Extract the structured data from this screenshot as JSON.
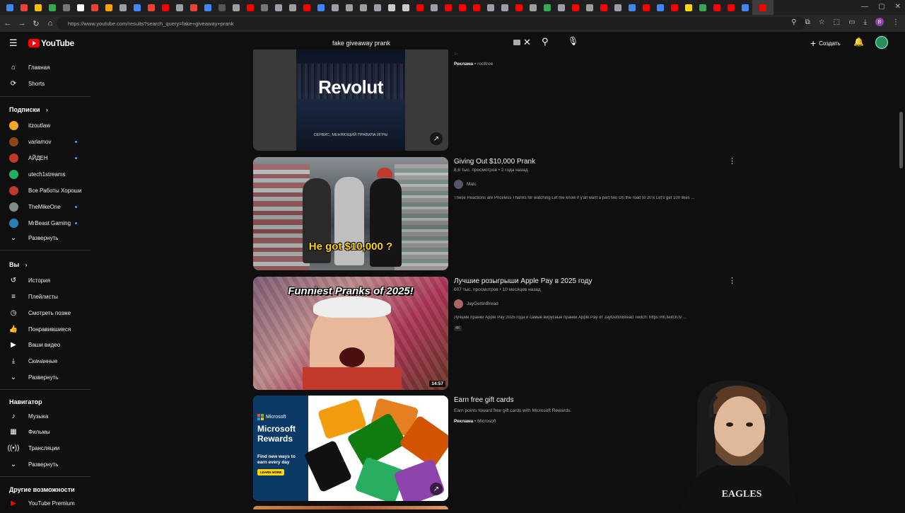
{
  "browser": {
    "url": "https://www.youtube.com/results?search_query=fake+giveaway+prank",
    "profile_initial": "B",
    "tab_colors": [
      "#4285f4",
      "#ea4335",
      "#fbbc05",
      "#34a853",
      "#777",
      "#fff",
      "#ea4335",
      "#ffa000",
      "#9aa0a6",
      "#4285f4",
      "#ea4335",
      "#ff0000",
      "#9aa0a6",
      "#ea4335",
      "#4285f4",
      "#555",
      "#9aa0a6",
      "#ff0000",
      "#777",
      "#9aa0a6",
      "#9aa0a6",
      "#ff0000",
      "#4285f4",
      "#9aa0a6",
      "#9aa0a6",
      "#9aa0a6",
      "#9aa0a6",
      "#ccc",
      "#ccc",
      "#ff0000",
      "#9aa0a6",
      "#ff0000",
      "#ff0000",
      "#ff0000",
      "#9aa0a6",
      "#9aa0a6",
      "#ff0000",
      "#9aa0a6",
      "#34a853",
      "#9aa0a6",
      "#ff0000",
      "#9aa0a6",
      "#ff0000",
      "#9aa0a6",
      "#4285f4",
      "#ff0000",
      "#4285f4",
      "#ff0000",
      "#ffd700",
      "#34a853",
      "#ff0000",
      "#ff0000",
      "#4285f4",
      "#ff0000"
    ]
  },
  "header": {
    "logo_text": "YouTube",
    "search_value": "fake giveaway prank",
    "create_label": "Создать"
  },
  "sidebar": {
    "home": "Главная",
    "shorts": "Shorts",
    "subscriptions_title": "Подписки",
    "channels": [
      {
        "name": "itzoutlaw",
        "color": "#f5a623",
        "live": false
      },
      {
        "name": "varlamov",
        "color": "#8b4513",
        "live": true
      },
      {
        "name": "АЙДЕН",
        "color": "#c0392b",
        "live": true
      },
      {
        "name": "utech1streams",
        "color": "#27ae60",
        "live": false
      },
      {
        "name": "Все Работы Хороши",
        "color": "#c0392b",
        "live": false
      },
      {
        "name": "TheMikeOne",
        "color": "#7f8c8d",
        "live": true
      },
      {
        "name": "MrBeast Gaming",
        "color": "#2980b9",
        "live": true
      }
    ],
    "expand": "Развернуть",
    "you_title": "Вы",
    "you_items": [
      "История",
      "Плейлисты",
      "Смотреть позже",
      "Понравившиеся",
      "Ваши видео",
      "Скачанные",
      "Развернуть"
    ],
    "navigator_title": "Навигатор",
    "navigator_items": [
      "Музыка",
      "Фильмы",
      "Трансляции",
      "Развернуть"
    ],
    "other_title": "Другие возможности",
    "premium": "YouTube Premium"
  },
  "results": {
    "ad_top": {
      "desc_partial": "...",
      "ad_label": "Реклама",
      "advertiser": "roottree",
      "thumb_title": "Revolut",
      "thumb_sub": "СЕРВИС, МЕНЯЮЩИЙ ПРАВИЛА ИГРЫ"
    },
    "video1": {
      "title": "Giving Out $10,000 Prank",
      "meta": "8,6 тыс. просмотров • 2 года назад",
      "channel": "Malc",
      "desc": "These Reactions are Priceless Thanks for watching Let me know if y'all want a part two On the road to 20 k Let's get 100 likes ...",
      "thumb_caption": "He got $10,000 ?"
    },
    "video2": {
      "title": "Лучшие розыгрыши Apple Pay в 2025 году",
      "meta": "607 тыс. просмотров • 10 месяцев назад",
      "channel": "JayGettinBread",
      "desc": "Лучшие пранки Apple Pay 2025 года и самые вирусные пранки Apple Pay от JayGettinBread Twitch: https://m.twitch.tv ...",
      "badge": "4K",
      "duration": "14:57",
      "thumb_caption": "Funniest Pranks of 2025!"
    },
    "ad_bottom": {
      "title": "Earn free gift cards",
      "desc": "Earn points toward free gift cards with Microsoft Rewards.",
      "ad_label": "Реклама",
      "advertiser": "Microsoft",
      "brand": "Microsoft",
      "headline": "Microsoft Rewards",
      "sub": "Find new ways to earn every day",
      "cta": "LEARN MORE"
    }
  }
}
